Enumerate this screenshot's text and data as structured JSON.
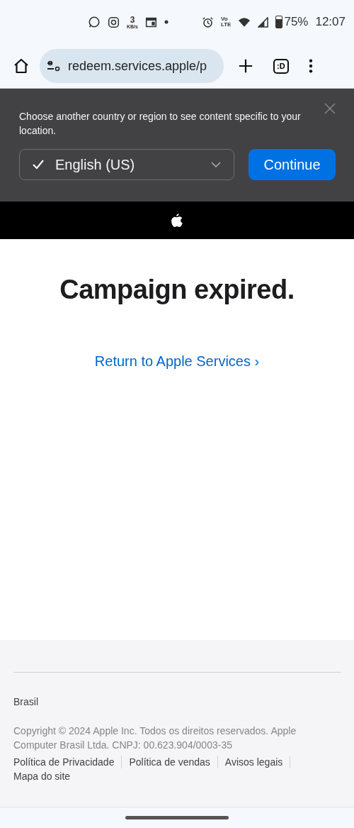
{
  "status_bar": {
    "speed_value": "3",
    "speed_unit": "KB/s",
    "network_top": "Vo",
    "network_bottom": "LTE",
    "battery": "75%",
    "time": "12:07"
  },
  "browser": {
    "url": "redeem.services.apple/p",
    "tab_label": ":D"
  },
  "region_banner": {
    "message": "Choose another country or region to see content specific to your location.",
    "language": "English (US)",
    "language_checked": true,
    "continue_label": "Continue"
  },
  "main": {
    "heading": "Campaign expired.",
    "link": "Return to Apple Services",
    "link_chevron": "›"
  },
  "footer": {
    "country": "Brasil",
    "copyright": "Copyright © 2024 Apple Inc. Todos os direitos reservados. Apple Computer Brasil Ltda. CNPJ: 00.623.904/0003-35",
    "links": [
      "Política de Privacidade",
      "Política de vendas",
      "Avisos legais",
      "Mapa do site"
    ]
  }
}
